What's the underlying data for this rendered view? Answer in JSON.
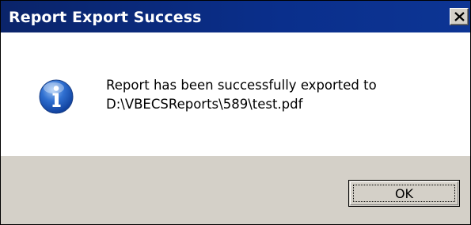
{
  "window": {
    "title": "Report Export Success",
    "close_icon": "close-icon"
  },
  "message": {
    "icon": "info-icon",
    "line1": "Report has been successfully exported to",
    "line2": "D:\\VBECSReports\\589\\test.pdf"
  },
  "buttons": {
    "ok_label": "OK"
  },
  "colors": {
    "titlebar": "#0a246a",
    "footer": "#d4d0c8",
    "icon_blue": "#1f5fc4"
  }
}
